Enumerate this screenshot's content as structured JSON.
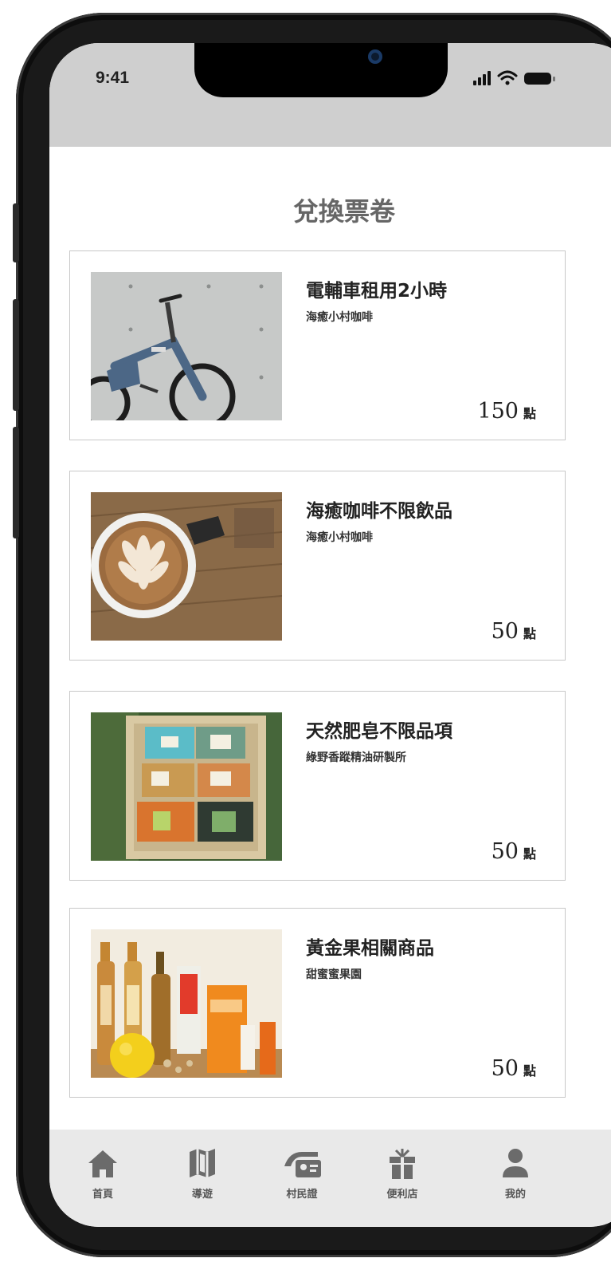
{
  "status_bar": {
    "time": "9:41"
  },
  "page": {
    "title": "兌換票卷"
  },
  "vouchers": [
    {
      "title": "電輔車租用2小時",
      "vendor": "海癒小村咖啡",
      "points": "150",
      "unit": "點",
      "image": "bicycle-photo"
    },
    {
      "title": "海癒咖啡不限飲品",
      "vendor": "海癒小村咖啡",
      "points": "50",
      "unit": "點",
      "image": "latte-photo"
    },
    {
      "title": "天然肥皂不限品項",
      "vendor": "綠野香蹤精油研製所",
      "points": "50",
      "unit": "點",
      "image": "soap-box-photo"
    },
    {
      "title": "黃金果相關商品",
      "vendor": "甜蜜蜜果園",
      "points": "50",
      "unit": "點",
      "image": "golden-fruit-products-photo"
    }
  ],
  "tab_bar": {
    "items": [
      {
        "label": "首頁",
        "icon": "home-icon"
      },
      {
        "label": "導遊",
        "icon": "map-icon"
      },
      {
        "label": "村民證",
        "icon": "id-card-icon"
      },
      {
        "label": "便利店",
        "icon": "gift-icon"
      },
      {
        "label": "我的",
        "icon": "user-icon"
      }
    ]
  },
  "colors": {
    "status_bar_bg": "#cfcfcf",
    "tab_bar_bg": "#e9e9e9",
    "title_text": "#666666",
    "icon_gray": "#6b6b6b"
  }
}
